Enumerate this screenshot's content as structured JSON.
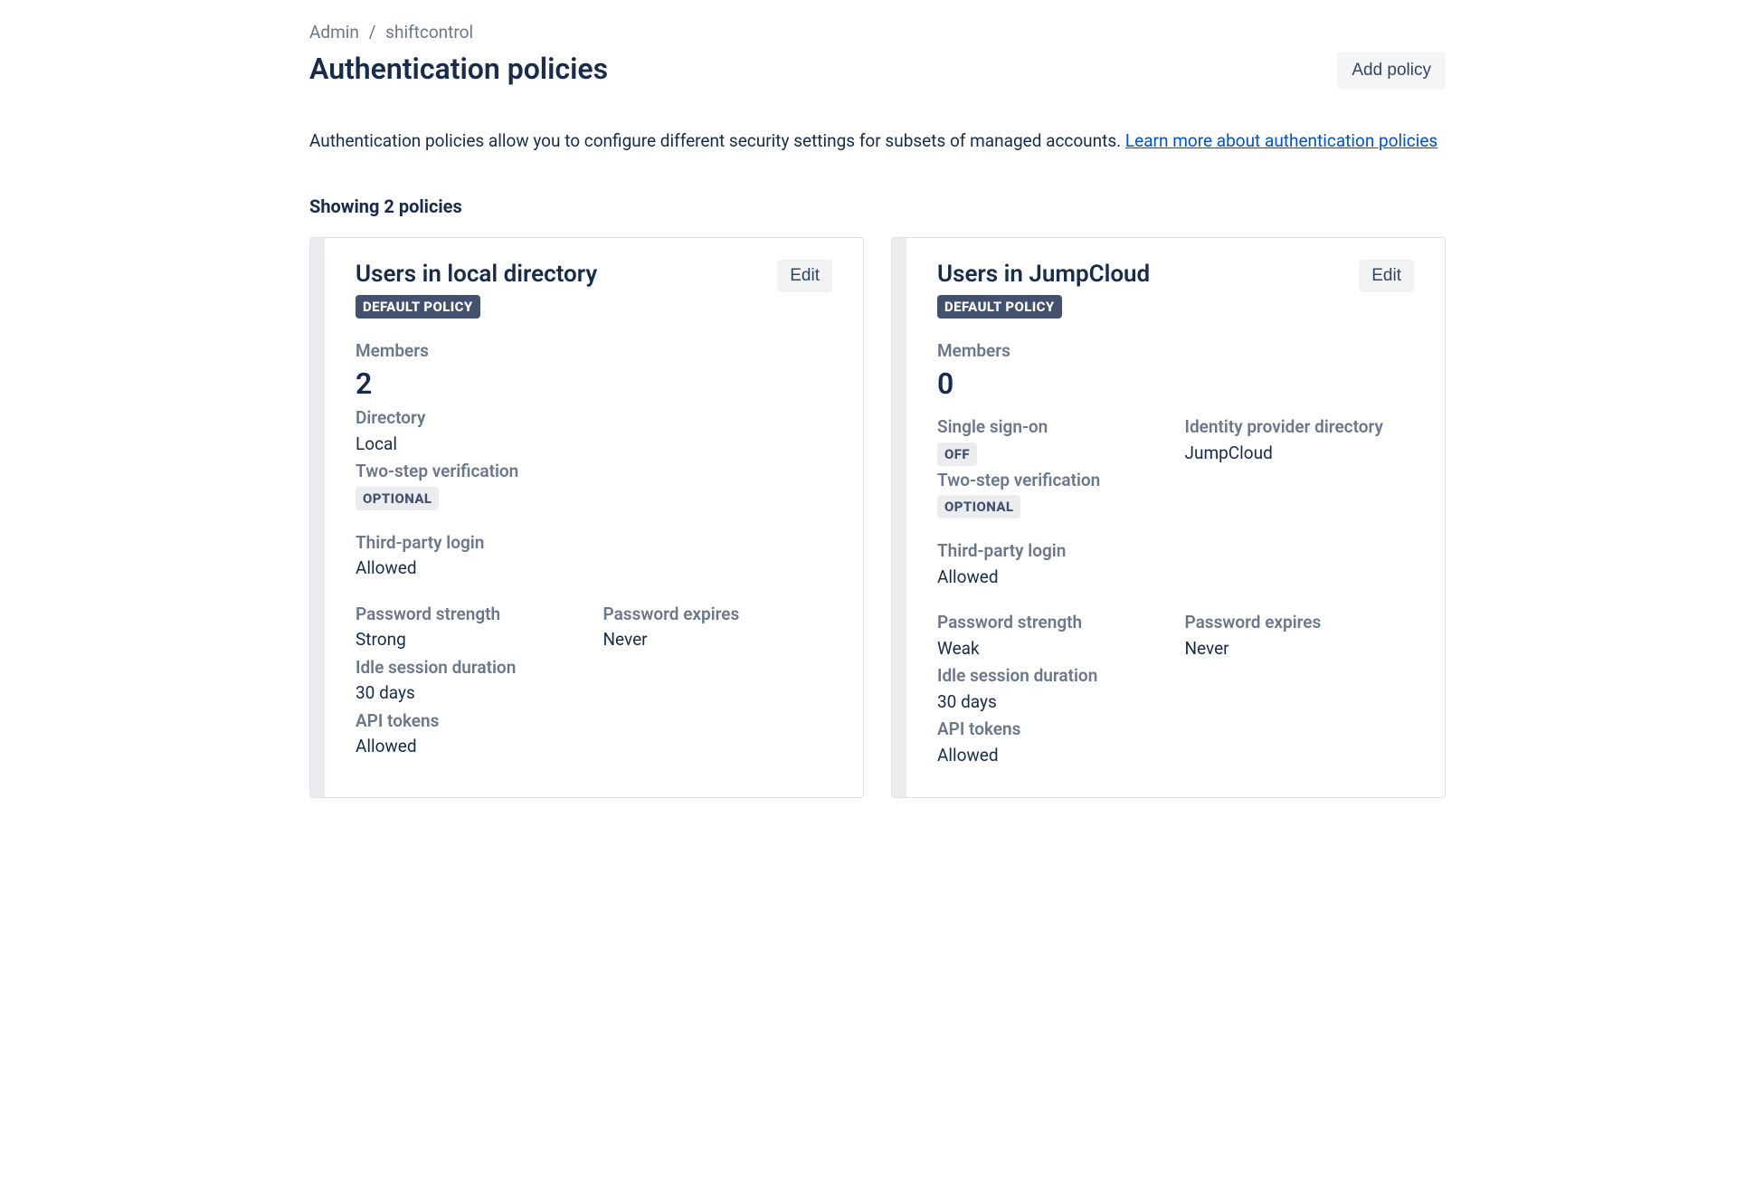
{
  "breadcrumb": {
    "root": "Admin",
    "org": "shiftcontrol"
  },
  "header": {
    "title": "Authentication policies",
    "add_button": "Add policy"
  },
  "intro": {
    "text_prefix": "Authentication policies allow you to configure different security settings for subsets of managed accounts. ",
    "learn_more": "Learn more about authentication policies"
  },
  "count_line": "Showing 2 policies",
  "labels": {
    "members": "Members",
    "directory": "Directory",
    "two_step": "Two-step verification",
    "third_party": "Third-party login",
    "password_strength": "Password strength",
    "password_expires": "Password expires",
    "idle_session": "Idle session duration",
    "api_tokens": "API tokens",
    "sso": "Single sign-on",
    "idp_directory": "Identity provider directory",
    "edit": "Edit",
    "default_badge": "DEFAULT POLICY"
  },
  "cards": [
    {
      "title": "Users in local directory",
      "is_default": true,
      "members": "2",
      "directory": "Local",
      "two_step": "OPTIONAL",
      "third_party": "Allowed",
      "password_strength": "Strong",
      "password_expires": "Never",
      "idle_session": "30 days",
      "api_tokens": "Allowed",
      "sso": null,
      "idp_directory": null
    },
    {
      "title": "Users in JumpCloud",
      "is_default": true,
      "members": "0",
      "directory": null,
      "two_step": "OPTIONAL",
      "third_party": "Allowed",
      "password_strength": "Weak",
      "password_expires": "Never",
      "idle_session": "30 days",
      "api_tokens": "Allowed",
      "sso": "OFF",
      "idp_directory": "JumpCloud"
    }
  ]
}
